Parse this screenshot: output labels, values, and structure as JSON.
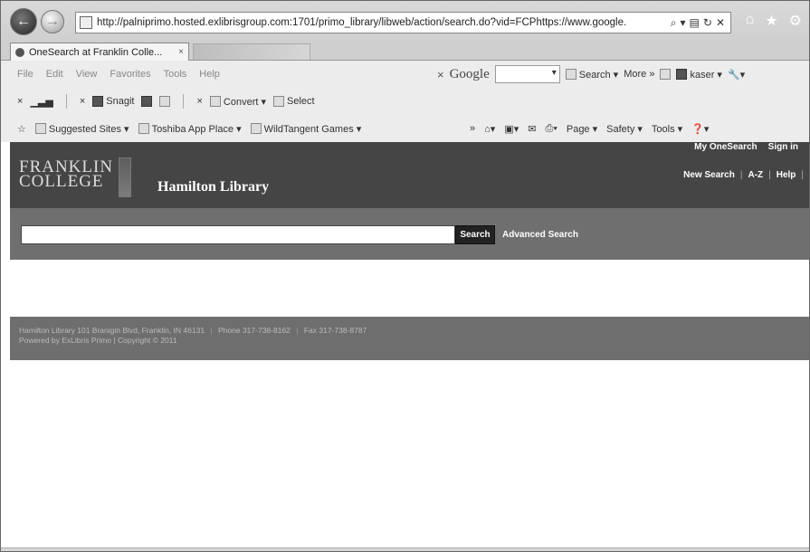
{
  "browser": {
    "url": "http://palniprimo.hosted.exlibrisgroup.com:1701/primo_library/libweb/action/search.do?vid=FCPhttps://www.google.",
    "addr_tools": [
      "⌕",
      "▾",
      "▤",
      "↻",
      "✕"
    ],
    "tab_title": "OneSearch at Franklin Colle...",
    "tab_close": "×"
  },
  "menu": [
    "File",
    "Edit",
    "View",
    "Favorites",
    "Tools",
    "Help"
  ],
  "google_bar": {
    "close": "×",
    "logo": "Google",
    "search_label": "Search ▾",
    "more_label": "More »",
    "user_label": "kaser ▾",
    "wrench": "🔧▾"
  },
  "tool_bar": {
    "close1": "×",
    "close2": "×",
    "snagit_label": "Snagit",
    "close3": "×",
    "convert_label": "Convert ▾",
    "select_label": "Select"
  },
  "favorites": {
    "suggested": "Suggested Sites ▾",
    "toshiba": "Toshiba App Place ▾",
    "wildtangent": "WildTangent Games ▾",
    "chevron": "»"
  },
  "command_bar": {
    "page": "Page ▾",
    "safety": "Safety ▾",
    "tools": "Tools ▾",
    "help": "❓▾"
  },
  "site": {
    "logo_line1": "FRANKLIN",
    "logo_line2": "COLLEGE",
    "library_name": "Hamilton Library",
    "my_onesearch": "My OneSearch",
    "sign_in": "Sign in",
    "new_search": "New Search",
    "az": "A-Z",
    "help": "Help",
    "pipe": "|",
    "search_placeholder": "",
    "search_button": "Search",
    "advanced_search": "Advanced Search",
    "footer_address": "Hamilton Library 101 Branigin Blvd, Franklin, IN 46131",
    "footer_phone": "Phone 317-738-8162",
    "footer_fax": "Fax 317-738-8787",
    "footer_powered": "Powered by ExLibris Primo | Copyright © 2011"
  }
}
